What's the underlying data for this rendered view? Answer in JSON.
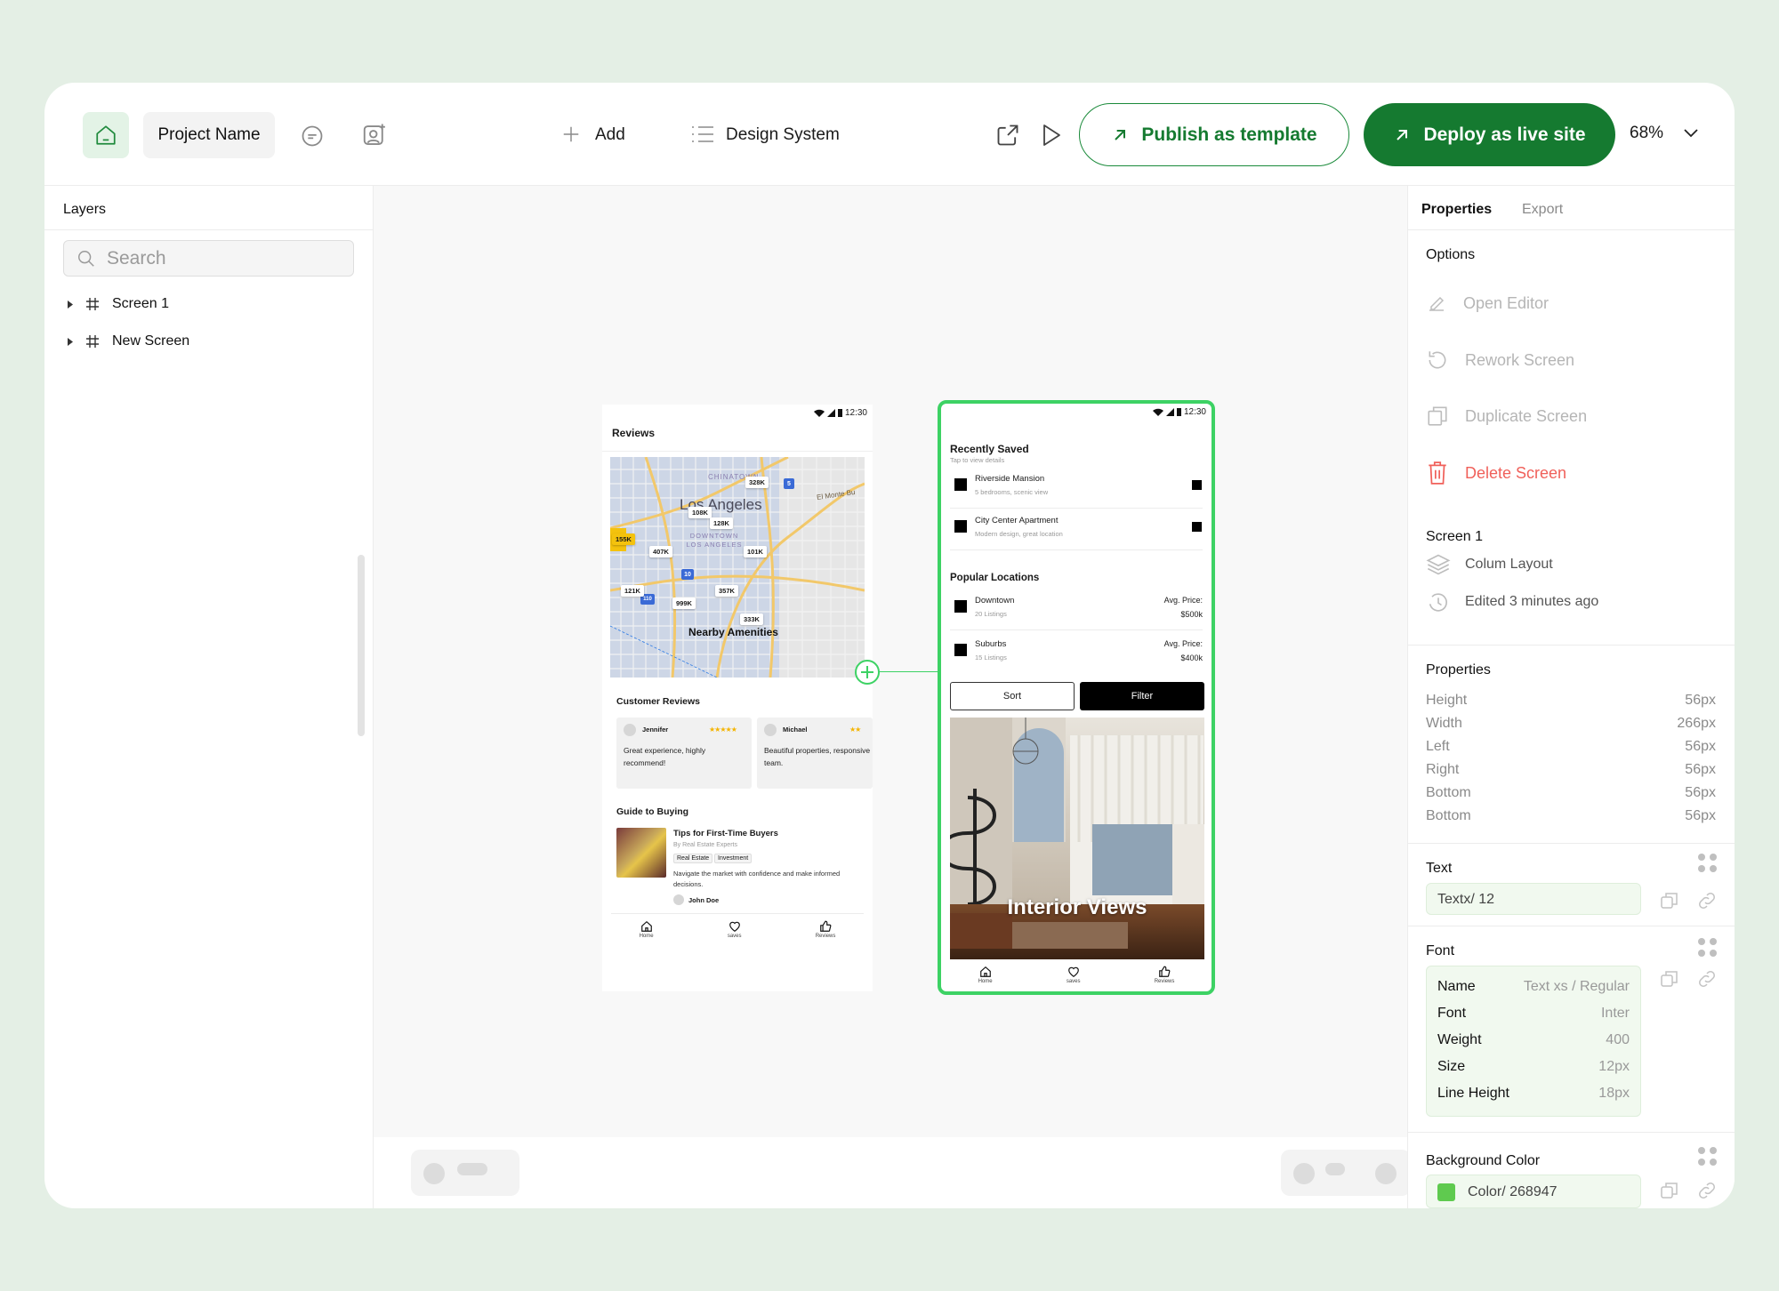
{
  "colors": {
    "brand_green": "#157a30",
    "selection_green": "#3dd264",
    "delete_red": "#f0605a",
    "background_color_swatch": "#5fca4f"
  },
  "topbar": {
    "project_name": "Project Name",
    "add_label": "Add",
    "design_system_label": "Design System",
    "publish_label": "Publish as template",
    "deploy_label": "Deploy as live site",
    "zoom_value": "68%"
  },
  "layers": {
    "title": "Layers",
    "search_placeholder": "Search",
    "items": [
      {
        "label": "Screen 1"
      },
      {
        "label": "New Screen"
      }
    ]
  },
  "screen1": {
    "status_time": "12:30",
    "header_title": "Reviews",
    "map": {
      "city_label": "Los Angeles",
      "chinatown_label": "CHINATOWN",
      "downtown_label": "DOWNTOWN LOS ANGELES",
      "el_monte_label": "El Monte Bu",
      "overlay_title": "Nearby Amenities",
      "prices": [
        "328K",
        "108K",
        "128K",
        "155K",
        "407K",
        "101K",
        "121K",
        "357K",
        "999K",
        "333K"
      ],
      "route_labels": [
        "5",
        "10",
        "110"
      ]
    },
    "reviews_title": "Customer Reviews",
    "reviews": [
      {
        "name": "Jennifer",
        "stars": "★★★★★",
        "text": "Great experience, highly recommend!"
      },
      {
        "name": "Michael",
        "stars": "★★",
        "text": "Beautiful properties, responsive team."
      }
    ],
    "guide_title": "Guide to Buying",
    "article": {
      "title": "Tips for First-Time Buyers",
      "byline": "By Real Estate Experts",
      "tags": [
        "Real Estate",
        "Investment"
      ],
      "body": "Navigate the market with confidence and make informed decisions.",
      "author": "John Doe"
    },
    "nav": [
      "Home",
      "saves",
      "Reviews"
    ]
  },
  "screen2": {
    "status_time": "12:30",
    "recent_title": "Recently Saved",
    "recent_sub": "Tap to view details",
    "saved": [
      {
        "name": "Riverside Mansion",
        "sub": "5 bedrooms, scenic view"
      },
      {
        "name": "City Center Apartment",
        "sub": "Modern design, great location"
      }
    ],
    "popular_title": "Popular Locations",
    "locations": [
      {
        "name": "Downtown",
        "sub": "20 Listings",
        "price_label": "Avg. Price:",
        "price": "$500k"
      },
      {
        "name": "Suburbs",
        "sub": "15 Listings",
        "price_label": "Avg. Price:",
        "price": "$400k"
      }
    ],
    "sort_label": "Sort",
    "filter_label": "Filter",
    "image_caption": "Interior Views",
    "nav": [
      "Home",
      "saves",
      "Reviews"
    ]
  },
  "right_panel": {
    "tabs": [
      "Properties",
      "Export"
    ],
    "options_title": "Options",
    "options": [
      {
        "label": "Open Editor",
        "icon": "pencil-icon"
      },
      {
        "label": "Rework Screen",
        "icon": "refresh-icon"
      },
      {
        "label": "Duplicate Screen",
        "icon": "duplicate-icon"
      },
      {
        "label": "Delete Screen",
        "icon": "trash-icon"
      }
    ],
    "screen_title": "Screen 1",
    "layout_label": "Colum Layout",
    "edited_label": "Edited 3 minutes ago",
    "properties_title": "Properties",
    "properties": [
      {
        "key": "Height",
        "value": "56px"
      },
      {
        "key": "Width",
        "value": "266px"
      },
      {
        "key": "Left",
        "value": "56px"
      },
      {
        "key": "Right",
        "value": "56px"
      },
      {
        "key": "Bottom",
        "value": "56px"
      },
      {
        "key": "Bottom",
        "value": "56px"
      }
    ],
    "text_title": "Text",
    "text_value": "Textx/  12",
    "font_title": "Font",
    "font": [
      {
        "key": "Name",
        "value": "Text xs / Regular"
      },
      {
        "key": "Font",
        "value": "Inter"
      },
      {
        "key": "Weight",
        "value": "400"
      },
      {
        "key": "Size",
        "value": "12px"
      },
      {
        "key": "Line Height",
        "value": "18px"
      }
    ],
    "bg_title": "Background Color",
    "bg_value": "Color/ 268947"
  }
}
